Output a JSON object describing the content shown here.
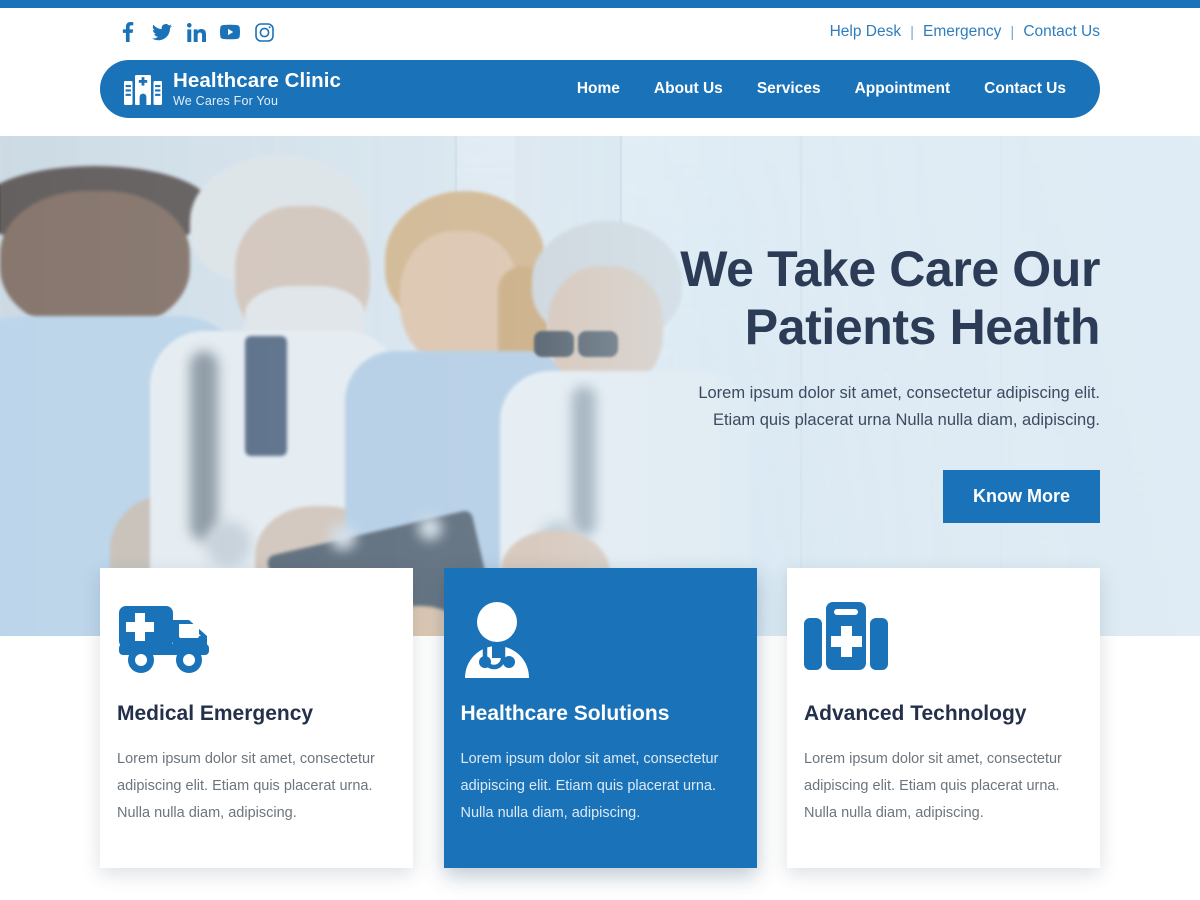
{
  "theme": {
    "primary_blue": "#1a72b8",
    "navy_text": "#24304a",
    "body_gray": "#6c757d",
    "link_blue": "#2f7dbd"
  },
  "utility_bar": {
    "social": [
      {
        "name": "facebook-icon",
        "label": "Facebook"
      },
      {
        "name": "twitter-icon",
        "label": "Twitter"
      },
      {
        "name": "linkedin-icon",
        "label": "LinkedIn"
      },
      {
        "name": "youtube-icon",
        "label": "YouTube"
      },
      {
        "name": "instagram-icon",
        "label": "Instagram"
      }
    ],
    "links": [
      {
        "label": "Help Desk"
      },
      {
        "label": "Emergency"
      },
      {
        "label": "Contact Us"
      }
    ],
    "separator": "|"
  },
  "header": {
    "brand_name": "Healthcare Clinic",
    "brand_tagline": "We Cares For You",
    "logo_icon": "hospital-building-icon",
    "nav": [
      {
        "label": "Home"
      },
      {
        "label": "About Us"
      },
      {
        "label": "Services"
      },
      {
        "label": "Appointment"
      },
      {
        "label": "Contact Us"
      }
    ]
  },
  "hero": {
    "title_line1": "We Take Care Our",
    "title_line2": "Patients Health",
    "subtitle_line1": "Lorem ipsum dolor sit amet, consectetur adipiscing elit.",
    "subtitle_line2": "Etiam quis placerat urna Nulla nulla diam, adipiscing.",
    "cta_label": "Know More",
    "image_alt": "Four medical professionals talking with a clipboard in a clinic"
  },
  "cards": [
    {
      "icon": "ambulance-icon",
      "title": "Medical Emergency",
      "text": "Lorem ipsum dolor sit amet, consectetur adipiscing elit. Etiam quis placerat urna. Nulla nulla diam, adipiscing.",
      "featured": false
    },
    {
      "icon": "doctor-stethoscope-icon",
      "title": "Healthcare Solutions",
      "text": "Lorem ipsum dolor sit amet, consectetur adipiscing elit. Etiam quis placerat urna. Nulla nulla diam, adipiscing.",
      "featured": true
    },
    {
      "icon": "medical-kit-icon",
      "title": "Advanced Technology",
      "text": "Lorem ipsum dolor sit amet, consectetur adipiscing elit. Etiam quis placerat urna. Nulla nulla diam, adipiscing.",
      "featured": false
    }
  ]
}
